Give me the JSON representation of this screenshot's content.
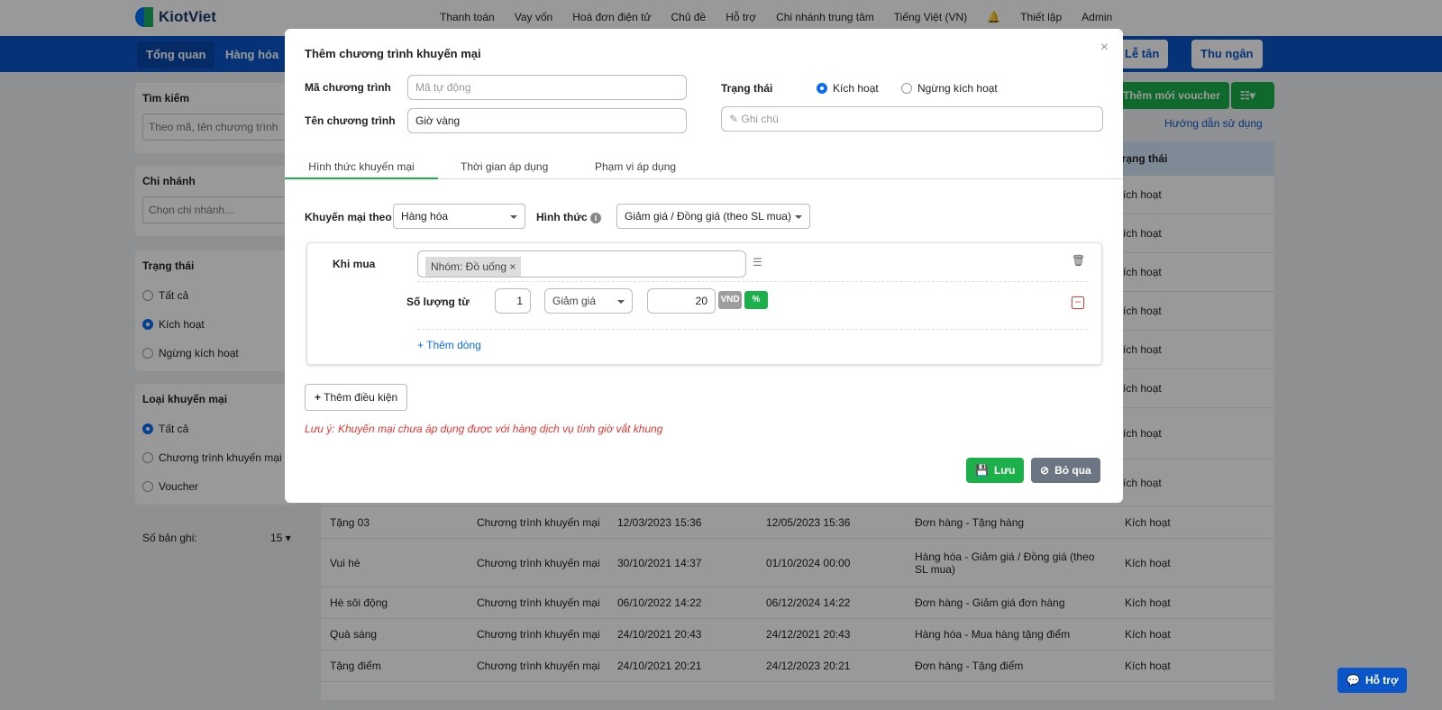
{
  "app": {
    "logo": "KiotViet"
  },
  "topnav": [
    "Thanh toán",
    "Vay vốn",
    "Hoá đơn điện tử",
    "Chủ đề",
    "Hỗ trợ",
    "Chi nhánh trung tâm",
    "Tiếng Việt (VN)",
    "Thiết lập",
    "Admin"
  ],
  "navbar": {
    "items": [
      "Tổng quan",
      "Hàng hóa"
    ],
    "right": [
      "Lễ tân",
      "Thu ngân"
    ]
  },
  "actions": {
    "add_voucher": "Thêm mới voucher",
    "guide": "Hướng dẫn sử dụng"
  },
  "sidebar": {
    "search": {
      "title": "Tìm kiếm",
      "placeholder": "Theo mã, tên chương trình"
    },
    "branch": {
      "title": "Chi nhánh",
      "placeholder": "Chọn chi nhánh..."
    },
    "status": {
      "title": "Trạng thái",
      "options": [
        "Tất cả",
        "Kích hoạt",
        "Ngừng kích hoạt"
      ],
      "selected": 1
    },
    "type": {
      "title": "Loại khuyến mại",
      "options": [
        "Tất cả",
        "Chương trình khuyến mại",
        "Voucher"
      ],
      "selected": 0
    },
    "records": {
      "label": "Số bản ghi:",
      "value": "15"
    }
  },
  "table": {
    "status_header": "Trạng thái",
    "hidden_status": [
      "Kích hoạt",
      "Kích hoạt",
      "Kích hoạt",
      "Kích hoạt",
      "Kích hoạt",
      "Kích hoạt",
      "Kích hoạt",
      "Kích hoạt"
    ],
    "rows": [
      [
        "Tặng 03",
        "Chương trình khuyến mại",
        "12/03/2023 15:36",
        "12/05/2023 15:36",
        "Đơn hàng - Tặng hàng",
        "Kích hoạt"
      ],
      [
        "Vui hè",
        "Chương trình khuyến mại",
        "30/10/2021 14:37",
        "01/10/2024 00:00",
        "Hàng hóa - Giảm giá / Đồng giá (theo SL mua)",
        "Kích hoạt"
      ],
      [
        "Hè sôi động",
        "Chương trình khuyến mại",
        "06/10/2022 14:22",
        "06/12/2024 14:22",
        "Đơn hàng - Giảm giá đơn hàng",
        "Kích hoạt"
      ],
      [
        "Quà sáng",
        "Chương trình khuyến mại",
        "24/10/2021 20:43",
        "24/12/2021 20:43",
        "Hàng hóa - Mua hàng tặng điểm",
        "Kích hoạt"
      ],
      [
        "Tặng điểm",
        "Chương trình khuyến mại",
        "24/10/2021 20:21",
        "24/12/2023 20:21",
        "Đơn hàng - Tặng điểm",
        "Kích hoạt"
      ]
    ]
  },
  "modal": {
    "title": "Thêm chương trình khuyến mại",
    "code_label": "Mã chương trình",
    "code_placeholder": "Mã tự động",
    "name_label": "Tên chương trình",
    "name_value": "Giờ vàng",
    "status_label": "Trạng thái",
    "status_options": [
      "Kích hoạt",
      "Ngừng kích hoạt"
    ],
    "note_placeholder": "Ghi chú",
    "tabs": [
      "Hình thức khuyến mại",
      "Thời gian áp dụng",
      "Phạm vi áp dụng"
    ],
    "promo_by_label": "Khuyến mại theo",
    "promo_by_value": "Hàng hóa",
    "form_label": "Hình thức",
    "form_value": "Giảm giá / Đồng giá (theo SL mua)",
    "when_buy_label": "Khi mua",
    "tag": "Nhóm: Đồ uống",
    "qty_label": "Số lượng từ",
    "qty_value": "1",
    "discount_type": "Giảm giá",
    "discount_value": "20",
    "unit_vnd": "VND",
    "unit_pct": "%",
    "add_row": "+ Thêm dòng",
    "add_condition": "Thêm điều kiện",
    "note": "Lưu ý: Khuyến mại chưa áp dụng được với hàng dịch vụ tính giờ vắt khung",
    "save": "Lưu",
    "cancel": "Bỏ qua"
  },
  "help_button": "Hỗ trợ",
  "colors": {
    "primary": "#0a55c8",
    "green": "#1bb04a",
    "warning": "#e53935"
  }
}
